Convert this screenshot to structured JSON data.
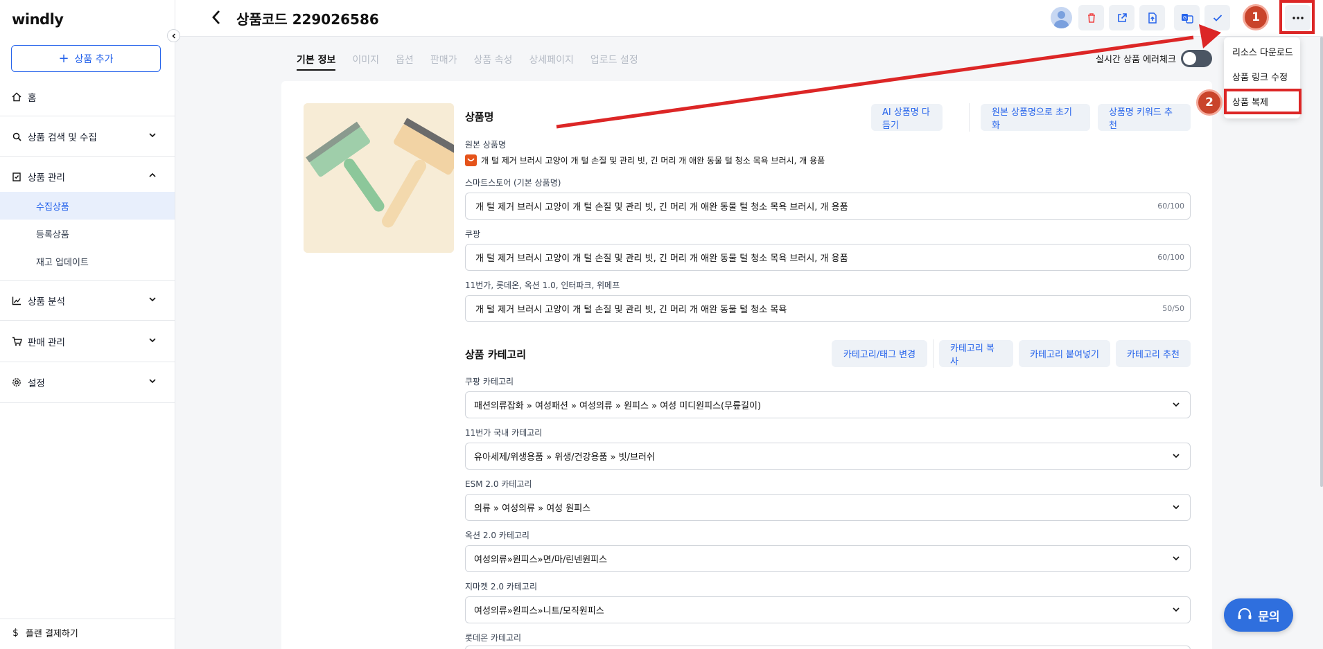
{
  "app": {
    "logo": "windly"
  },
  "sidebar": {
    "add_button": "상품 추가",
    "home": "홈",
    "sections": [
      {
        "label": "상품 검색 및 수집"
      },
      {
        "label": "상품 관리"
      },
      {
        "label": "상품 분석"
      },
      {
        "label": "판매 관리"
      },
      {
        "label": "설정"
      }
    ],
    "sub_items": [
      "수집상품",
      "등록상품",
      "재고 업데이트"
    ],
    "plan": "플랜 결제하기"
  },
  "header": {
    "title": "상품코드 229026586"
  },
  "tabs": [
    "기본 정보",
    "이미지",
    "옵션",
    "판매가",
    "상품 속성",
    "상세페이지",
    "업로드 설정"
  ],
  "realtime_check": "실시간 상품 에러체크",
  "menu": {
    "items": [
      "리소스 다운로드",
      "상품 링크 수정",
      "상품 복제"
    ]
  },
  "steps": [
    "1",
    "2"
  ],
  "product_name": {
    "title": "상품명",
    "buttons": [
      "AI 상품명 다듬기",
      "원본 상품명으로 초기화",
      "상품명 키워드 추천"
    ],
    "original_label": "원본 상품명",
    "original_value": "개 털 제거 브러시 고양이 개 털 손질 및 관리 빗, 긴 머리 개 애완 동물 털 청소 목욕 브러시, 개 용품",
    "fields": [
      {
        "label": "스마트스토어 (기본 상품명)",
        "value": "개 털 제거 브러시 고양이 개 털 손질 및 관리 빗, 긴 머리 개 애완 동물 털 청소 목욕 브러시, 개 용품",
        "counter": "60/100"
      },
      {
        "label": "쿠팡",
        "value": "개 털 제거 브러시 고양이 개 털 손질 및 관리 빗, 긴 머리 개 애완 동물 털 청소 목욕 브러시, 개 용품",
        "counter": "60/100"
      },
      {
        "label": "11번가, 롯데온, 옥션 1.0, 인터파크, 위메프",
        "value": "개 털 제거 브러시 고양이 개 털 손질 및 관리 빗, 긴 머리 개 애완 동물 털 청소 목욕",
        "counter": "50/50"
      }
    ]
  },
  "category": {
    "title": "상품 카테고리",
    "buttons": [
      "카테고리/태그 변경",
      "카테고리 복사",
      "카테고리 붙여넣기",
      "카테고리 추천"
    ],
    "fields": [
      {
        "label": "쿠팡 카테고리",
        "value": "패션의류잡화 » 여성패션 » 여성의류 » 원피스 » 여성 미디원피스(무릎길이)"
      },
      {
        "label": "11번가 국내 카테고리",
        "value": "유아세제/위생용품 » 위생/건강용품 » 빗/브러쉬"
      },
      {
        "label": "ESM 2.0 카테고리",
        "value": "의류 » 여성의류 » 여성 원피스"
      },
      {
        "label": "옥션 2.0 카테고리",
        "value": "여성의류»원피스»면/마/린넨원피스"
      },
      {
        "label": "지마켓 2.0 카테고리",
        "value": "여성의류»원피스»니트/모직원피스"
      },
      {
        "label": "롯데온 카테고리",
        "value": ""
      }
    ]
  },
  "chat": {
    "label": "문의"
  },
  "colors": {
    "accent": "#2563eb",
    "annotation": "#dc2626"
  }
}
